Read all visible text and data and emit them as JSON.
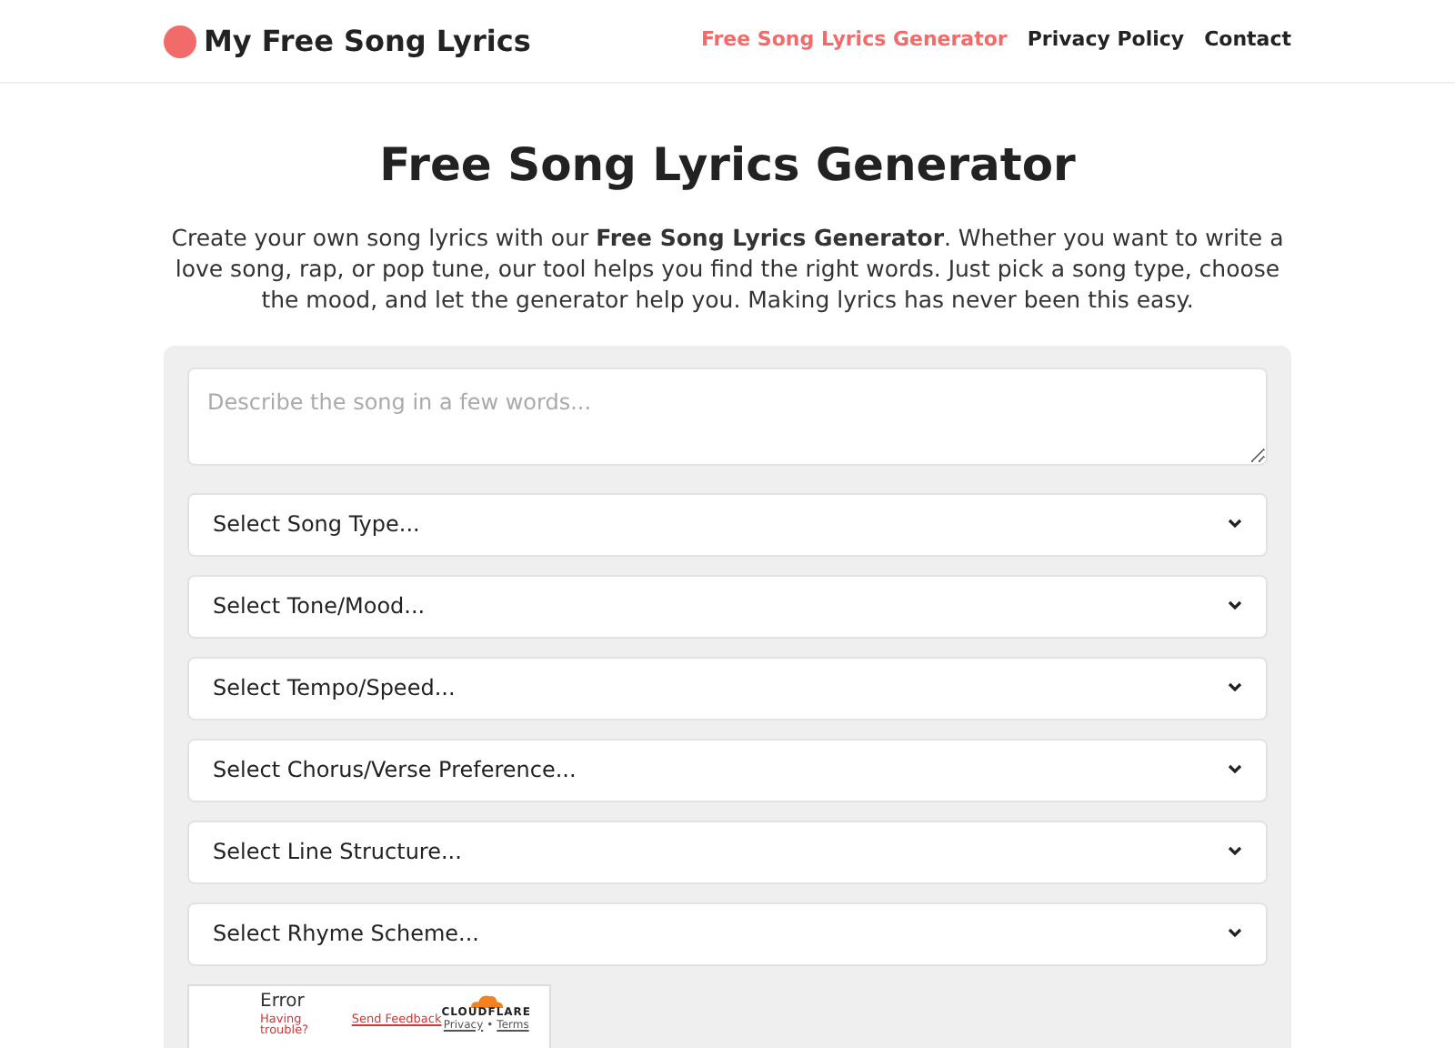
{
  "header": {
    "logo": "My Free Song Lyrics",
    "nav": [
      {
        "label": "Free Song Lyrics Generator",
        "selected": true
      },
      {
        "label": "Privacy Policy",
        "selected": false
      },
      {
        "label": "Contact",
        "selected": false
      }
    ]
  },
  "title": "Free Song Lyrics Generator",
  "intro": "Create your own song lyrics with our **Free Song Lyrics Generator**. Whether you want to write a love song, rap, or pop tune, our tool helps you find the right words. Just pick a song type, choose the mood, and let the generator help you. Making lyrics has never been this easy.",
  "form": {
    "description": {
      "placeholder": "Describe the song in a few words..."
    },
    "selects": [
      "Select Song Type...",
      "Select Tone/Mood...",
      "Select Tempo/Speed...",
      "Select Chorus/Verse Preference...",
      "Select Line Structure...",
      "Select Rhyme Scheme..."
    ],
    "captcha": {
      "status": "Error",
      "help": "Having trouble?",
      "feedback": "Send Feedback",
      "brand": "CLOUDFLARE",
      "privacy": "Privacy",
      "separator": "•",
      "terms": "Terms"
    }
  }
}
